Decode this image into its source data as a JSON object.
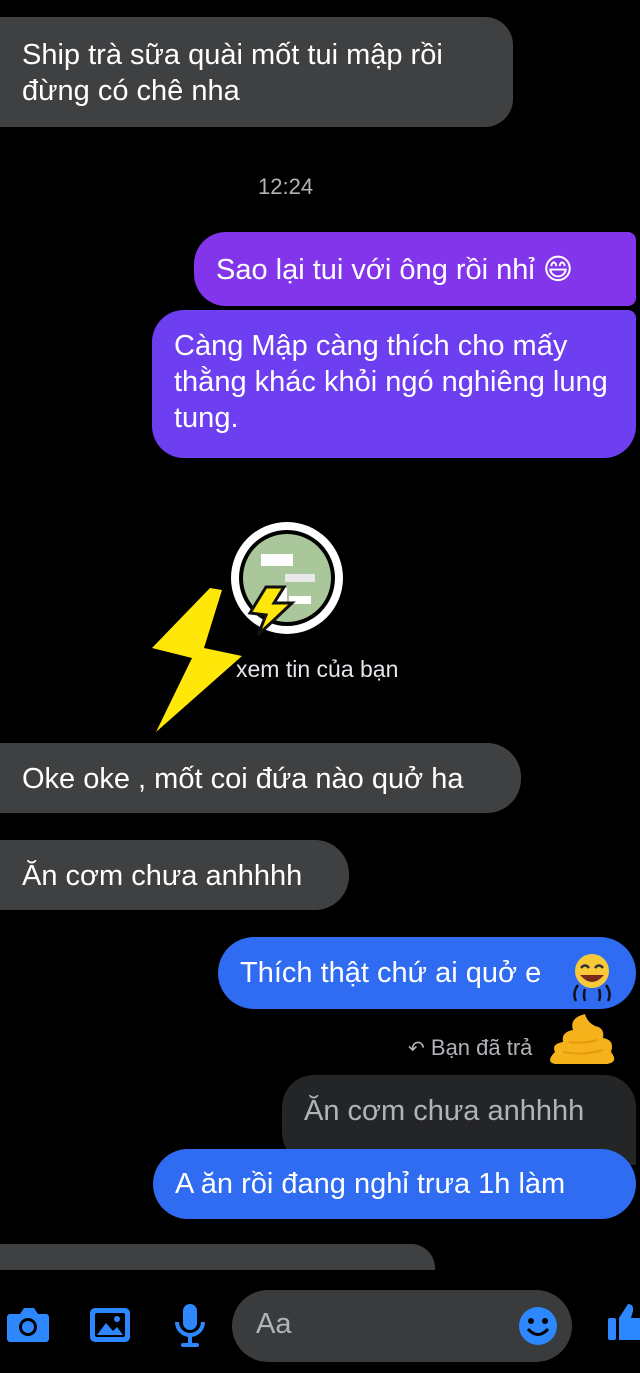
{
  "messages": {
    "m1": "Ship trà sữa quài mốt tui mập rồi đừng có chê nha",
    "time": "12:24",
    "m2": "Sao lại tui với ông rồi nhỉ 😄",
    "m3": "Càng Mập càng thích cho mấy thằng khác khỏi ngó nghiêng lung tung.",
    "story_caption": "xem tin của bạn",
    "m4": "Oke oke , mốt coi đứa nào quở ha",
    "m5": "Ăn cơm chưa anhhhh",
    "m6": "Thích thật chứ ai quở e",
    "reply_label": "Bạn đã trả",
    "quoted": "Ăn cơm chưa anhhhh",
    "m7": "A ăn rồi đang nghỉ trưa 1h làm"
  },
  "composer": {
    "placeholder": "Aa",
    "icons": [
      "camera-icon",
      "gallery-icon",
      "microphone-icon",
      "emoji-icon",
      "like-icon"
    ]
  },
  "colors": {
    "background": "#000000",
    "incoming": "#3e4042",
    "outgoing_purple": "#8235ea",
    "outgoing_violet": "#6d3ff0",
    "outgoing_blue": "#2f6cf2",
    "accent": "#2d88ff"
  }
}
